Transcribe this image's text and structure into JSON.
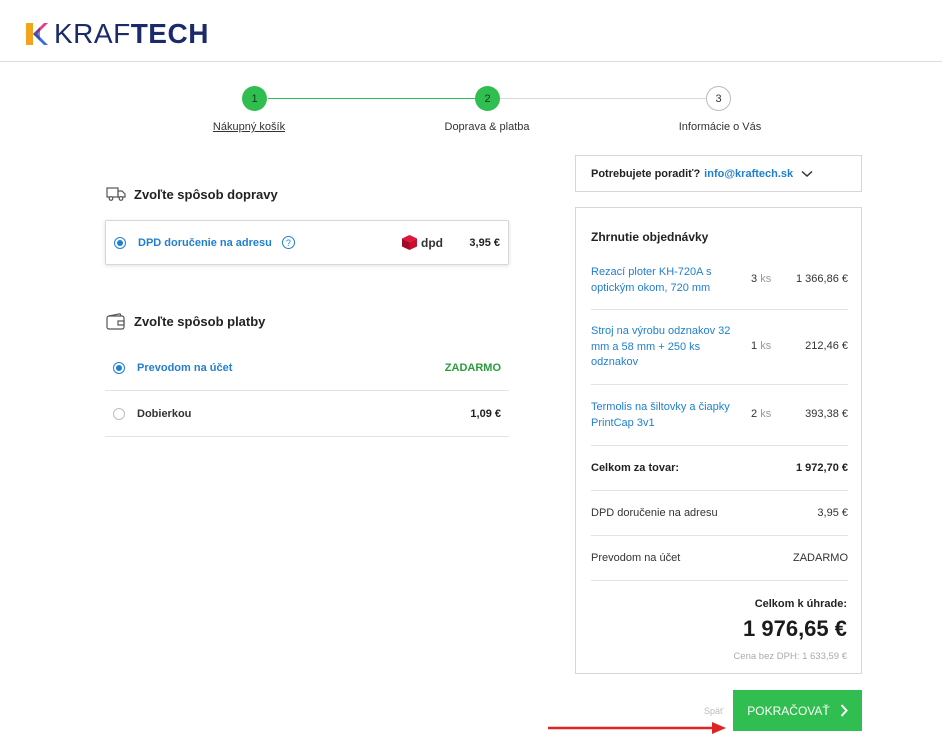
{
  "brand": {
    "name_light": "KRAF",
    "name_bold": "TECH"
  },
  "stepper": {
    "steps": [
      {
        "number": "1",
        "label": "Nákupný košík"
      },
      {
        "number": "2",
        "label": "Doprava & platba"
      },
      {
        "number": "3",
        "label": "Informácie o Vás"
      }
    ]
  },
  "shipping": {
    "title": "Zvoľte spôsob dopravy",
    "option": {
      "label": "DPD doručenie na adresu",
      "help": "?",
      "carrier": "dpd",
      "price": "3,95 €",
      "selected": true
    }
  },
  "payment": {
    "title": "Zvoľte spôsob platby",
    "options": [
      {
        "label": "Prevodom na účet",
        "price": "ZADARMO",
        "selected": true
      },
      {
        "label": "Dobierkou",
        "price": "1,09 €",
        "selected": false
      }
    ]
  },
  "advice": {
    "text": "Potrebujete poradiť?",
    "email": "info@kraftech.sk"
  },
  "summary": {
    "title": "Zhrnutie objednávky",
    "items": [
      {
        "name": "Rezací ploter KH-720A s optickým okom, 720 mm",
        "qty": "3",
        "unit": "ks",
        "price": "1 366,86 €"
      },
      {
        "name": "Stroj na výrobu odznakov 32 mm a 58 mm + 250 ks odznakov",
        "qty": "1",
        "unit": "ks",
        "price": "212,46 €"
      },
      {
        "name": "Termolis na šiltovky a čiapky PrintCap 3v1",
        "qty": "2",
        "unit": "ks",
        "price": "393,38 €"
      }
    ],
    "goods_total": {
      "label": "Celkom za tovar:",
      "value": "1 972,70 €"
    },
    "shipping_row": {
      "label": "DPD doručenie na adresu",
      "value": "3,95 €"
    },
    "payment_row": {
      "label": "Prevodom na účet",
      "value": "ZADARMO"
    },
    "grand_total": {
      "label": "Celkom k úhrade:",
      "value": "1 976,65 €",
      "net_label": "Cena bez DPH:",
      "net_value": "1 633,59 €"
    }
  },
  "actions": {
    "back": "Späť",
    "continue": "POKRAČOVAŤ"
  },
  "colors": {
    "accent_green": "#2fbe4f",
    "link_blue": "#1f7fd1",
    "brand_navy": "#1b2a6b",
    "arrow_red": "#e02424"
  }
}
